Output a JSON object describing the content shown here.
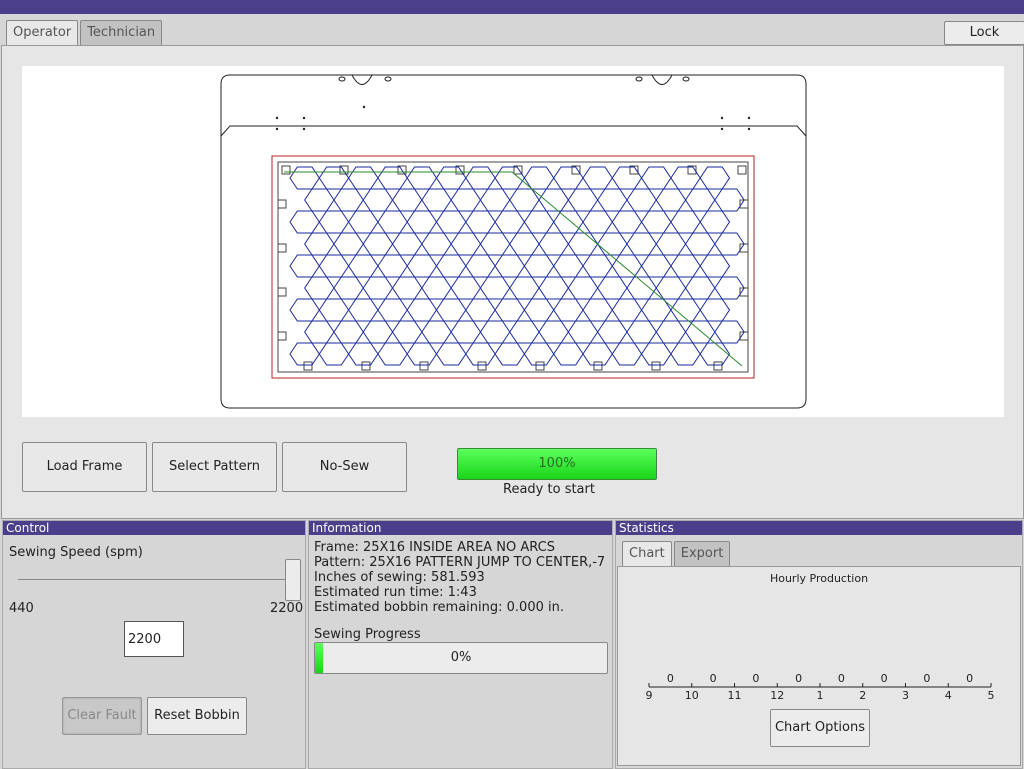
{
  "tabs": [
    "Operator",
    "Technician"
  ],
  "lock_label": "Lock",
  "buttons": {
    "load_frame": "Load Frame",
    "select_pattern": "Select Pattern",
    "no_sew": "No-Sew"
  },
  "main_progress": {
    "value_text": "100%",
    "status": "Ready to start"
  },
  "control": {
    "title": "Control",
    "speed_label": "Sewing Speed (spm)",
    "min": "440",
    "max": "2200",
    "value": "2200",
    "clear_fault": "Clear Fault",
    "reset_bobbin": "Reset Bobbin"
  },
  "info": {
    "title": "Information",
    "frame": "Frame: 25X16 INSIDE AREA NO ARCS",
    "pattern": "Pattern: 25X16 PATTERN JUMP TO CENTER,-7",
    "inches": "Inches of sewing: 581.593",
    "run_time": "Estimated run time: 1:43",
    "bobbin": "Estimated bobbin remaining: 0.000 in.",
    "progress_label": "Sewing Progress",
    "progress_text": "0%"
  },
  "stats": {
    "title": "Statistics",
    "tabs": [
      "Chart",
      "Export"
    ],
    "chart_options": "Chart Options"
  },
  "chart_data": {
    "type": "bar",
    "title": "Hourly Production",
    "categories": [
      "9",
      "10",
      "11",
      "12",
      "1",
      "2",
      "3",
      "4",
      "5"
    ],
    "values": [
      0,
      0,
      0,
      0,
      0,
      0,
      0,
      0
    ],
    "value_labels": [
      "0",
      "0",
      "0",
      "0",
      "0",
      "0",
      "0",
      "0"
    ]
  }
}
